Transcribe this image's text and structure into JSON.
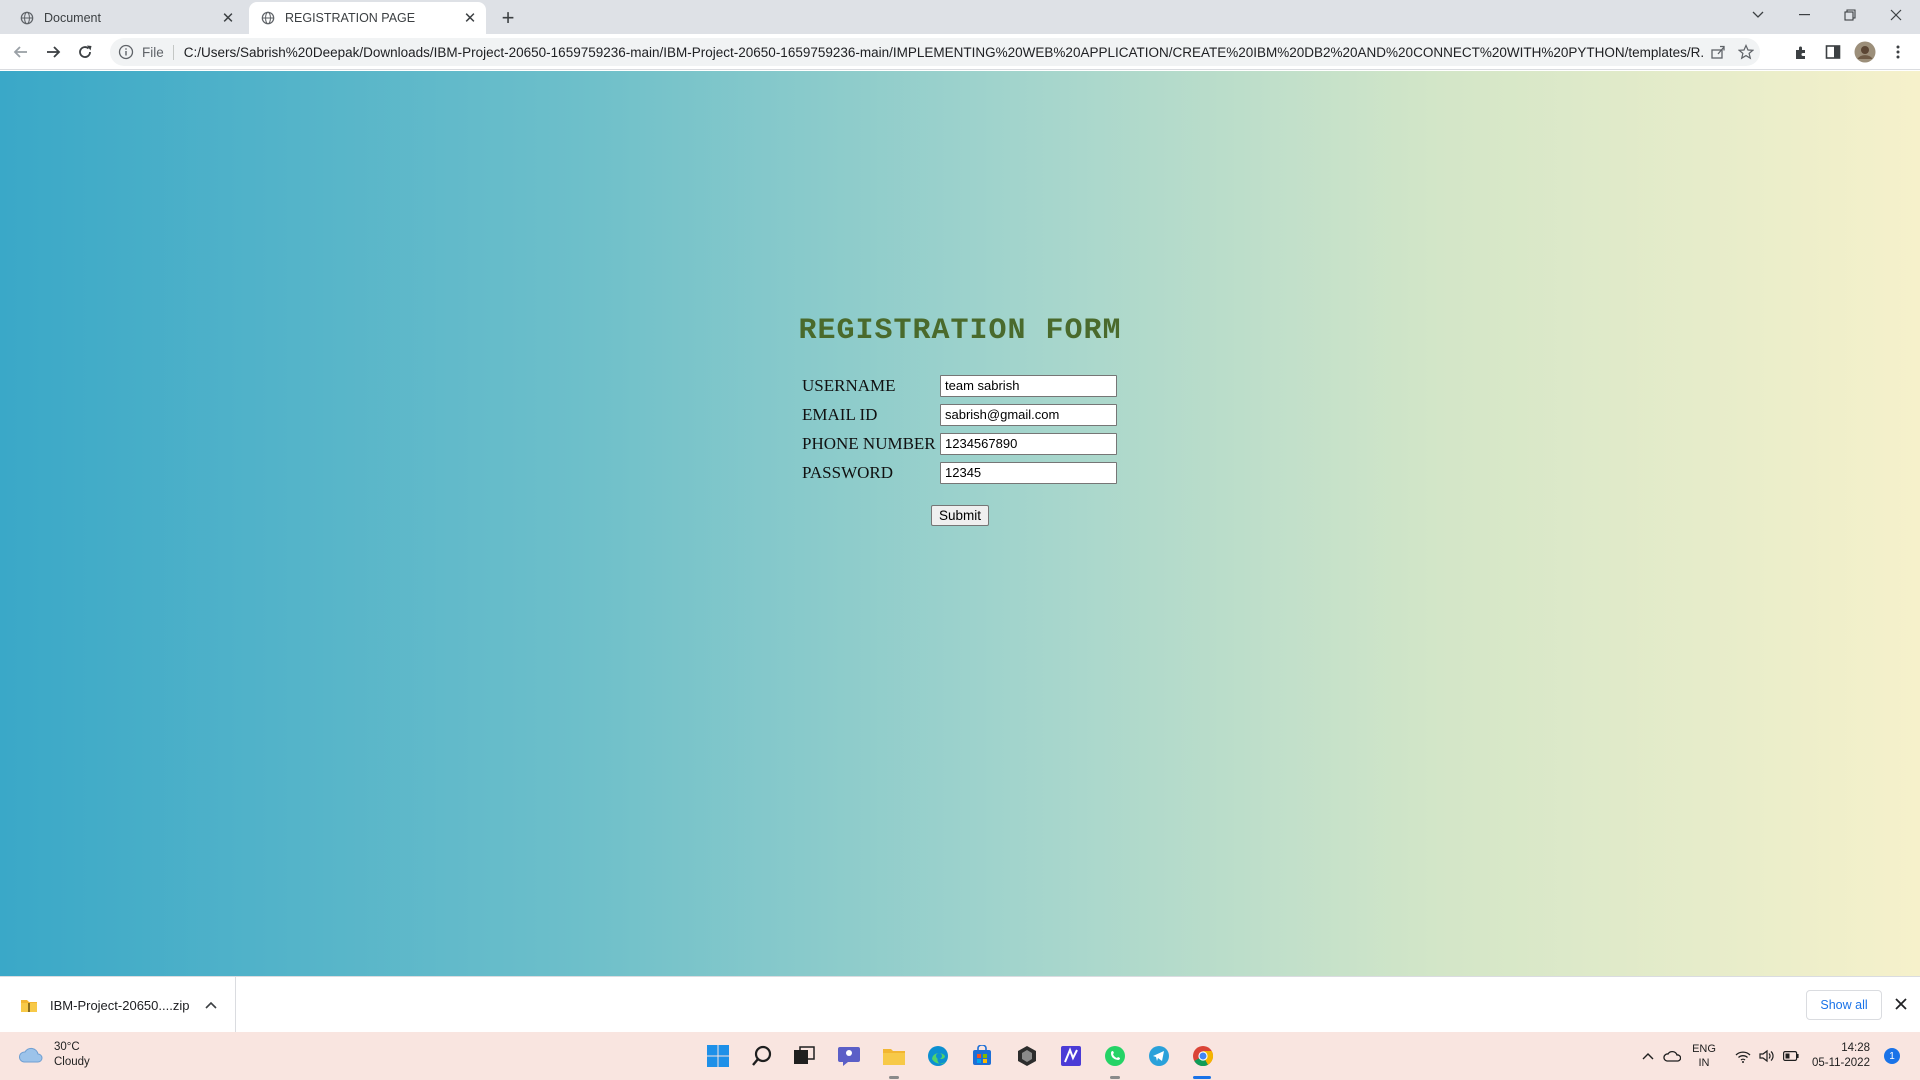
{
  "browser": {
    "tabs": [
      {
        "title": "Document"
      },
      {
        "title": "REGISTRATION PAGE"
      }
    ],
    "file_label": "File",
    "url": "C:/Users/Sabrish%20Deepak/Downloads/IBM-Project-20650-1659759236-main/IBM-Project-20650-1659759236-main/IMPLEMENTING%20WEB%20APPLICATION/CREATE%20IBM%20DB2%20AND%20CONNECT%20WITH%20PYTHON/templates/R..."
  },
  "page": {
    "title": "REGISTRATION FORM",
    "fields": [
      {
        "label": "USERNAME",
        "value": "team sabrish"
      },
      {
        "label": "EMAIL ID",
        "value": "sabrish@gmail.com"
      },
      {
        "label": "PHONE NUMBER",
        "value": "1234567890"
      },
      {
        "label": "PASSWORD",
        "value": "12345"
      }
    ],
    "submit_label": "Submit",
    "colors": {
      "title": "#4a6a2c",
      "gradient_start": "#3aa8c8",
      "gradient_end": "#f6f1cb"
    }
  },
  "downloads": {
    "item": "IBM-Project-20650....zip",
    "show_all": "Show all"
  },
  "taskbar": {
    "weather": {
      "temp": "30°C",
      "condition": "Cloudy"
    },
    "lang": {
      "code": "ENG",
      "region": "IN"
    },
    "time": "14:28",
    "date": "05-11-2022",
    "notifications": "1",
    "apps": [
      "start-icon",
      "search-icon",
      "task-view-icon",
      "chat-icon",
      "file-explorer-icon",
      "edge-icon",
      "store-icon",
      "app-cube-icon",
      "app-n-icon",
      "whatsapp-icon",
      "telegram-icon",
      "chrome-icon"
    ]
  }
}
